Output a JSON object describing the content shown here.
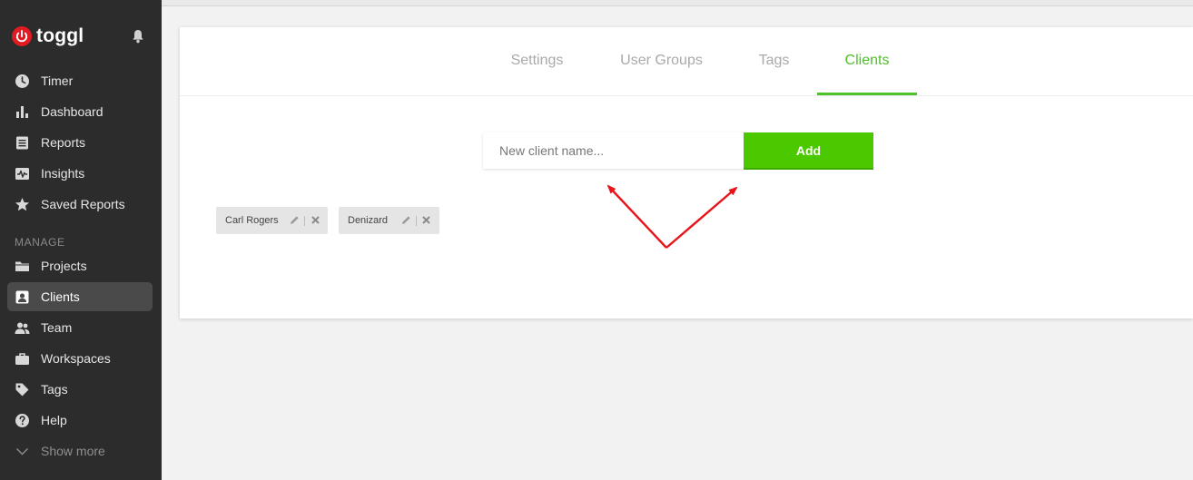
{
  "app": {
    "brand": "toggl",
    "brand_color": "#e01b22"
  },
  "sidebar": {
    "top_items": [
      {
        "label": "Timer",
        "icon": "clock-icon"
      },
      {
        "label": "Dashboard",
        "icon": "bar-chart-icon"
      },
      {
        "label": "Reports",
        "icon": "document-icon"
      },
      {
        "label": "Insights",
        "icon": "pulse-icon"
      },
      {
        "label": "Saved Reports",
        "icon": "star-icon"
      }
    ],
    "section_label": "MANAGE",
    "manage_items": [
      {
        "label": "Projects",
        "icon": "folder-icon"
      },
      {
        "label": "Clients",
        "icon": "client-card-icon",
        "active": true
      },
      {
        "label": "Team",
        "icon": "team-icon"
      },
      {
        "label": "Workspaces",
        "icon": "briefcase-icon"
      },
      {
        "label": "Tags",
        "icon": "tag-icon"
      },
      {
        "label": "Help",
        "icon": "help-icon"
      },
      {
        "label": "Show more",
        "icon": "chevron-down-icon"
      }
    ]
  },
  "tabs": [
    {
      "label": "Settings"
    },
    {
      "label": "User Groups"
    },
    {
      "label": "Tags"
    },
    {
      "label": "Clients",
      "active": true
    }
  ],
  "new_client": {
    "placeholder": "New client name...",
    "value": "",
    "add_label": "Add"
  },
  "clients": [
    {
      "name": "Carl Rogers"
    },
    {
      "name": "Denizard"
    }
  ],
  "colors": {
    "accent": "#4dc22b",
    "button": "#4bc800",
    "sidebar_bg": "#2c2c2c",
    "annotation": "#e8141b"
  }
}
